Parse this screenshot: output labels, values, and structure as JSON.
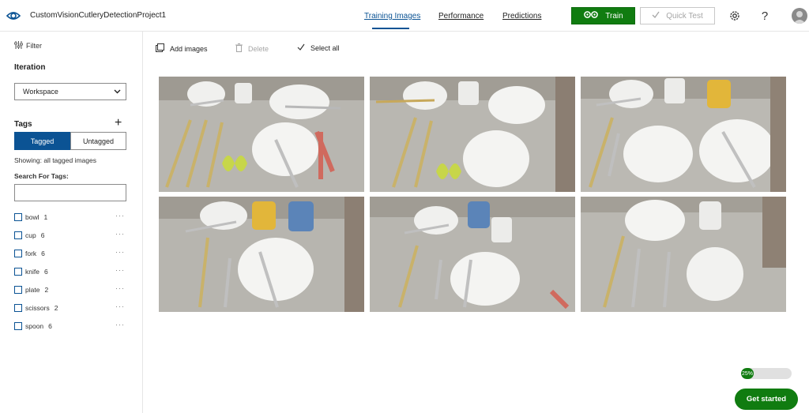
{
  "header": {
    "project_name": "CustomVisionCutleryDetectionProject1",
    "eye_icon": "eye-icon",
    "nav": [
      {
        "label": "Training Images",
        "active": true
      },
      {
        "label": "Performance",
        "active": false
      },
      {
        "label": "Predictions",
        "active": false
      }
    ],
    "train_label": "Train",
    "quick_test_label": "Quick Test",
    "settings_icon": "gear-icon",
    "help_label": "?",
    "avatar_icon": "avatar-icon"
  },
  "sidebar": {
    "filter_label": "Filter",
    "iteration_heading": "Iteration",
    "iteration_value": "Workspace",
    "tags_heading": "Tags",
    "add_tag_label": "+",
    "toggle": {
      "tagged": "Tagged",
      "untagged": "Untagged"
    },
    "showing_text": "Showing: all tagged images",
    "search_label": "Search For Tags:",
    "search_value": "",
    "tags": [
      {
        "name": "bowl",
        "count": "1"
      },
      {
        "name": "cup",
        "count": "6"
      },
      {
        "name": "fork",
        "count": "6"
      },
      {
        "name": "knife",
        "count": "6"
      },
      {
        "name": "plate",
        "count": "2"
      },
      {
        "name": "scissors",
        "count": "2"
      },
      {
        "name": "spoon",
        "count": "6"
      }
    ],
    "more_label": "···"
  },
  "toolbar": {
    "add_images": "Add images",
    "delete": "Delete",
    "select_all": "Select all"
  },
  "images": [
    {
      "alt": "table with bowl, mugs, plates, knife, spoon, fork, scissors"
    },
    {
      "alt": "table with bowl, mug, plates, knife, fork, scissors"
    },
    {
      "alt": "table with bowl, mugs, plates, knife, spoon, fork"
    },
    {
      "alt": "table with bowl, mugs, plate, knife, spoon, fork"
    },
    {
      "alt": "table with bowl, mugs, plate, knife, spoon, fork, scissors"
    },
    {
      "alt": "table with plate, mug, bowl, knife, fork, spoon"
    }
  ],
  "progress": {
    "label": "25%",
    "value": 0.25
  },
  "get_started_label": "Get started",
  "colors": {
    "accent": "#0b5394",
    "train": "#107c10"
  }
}
